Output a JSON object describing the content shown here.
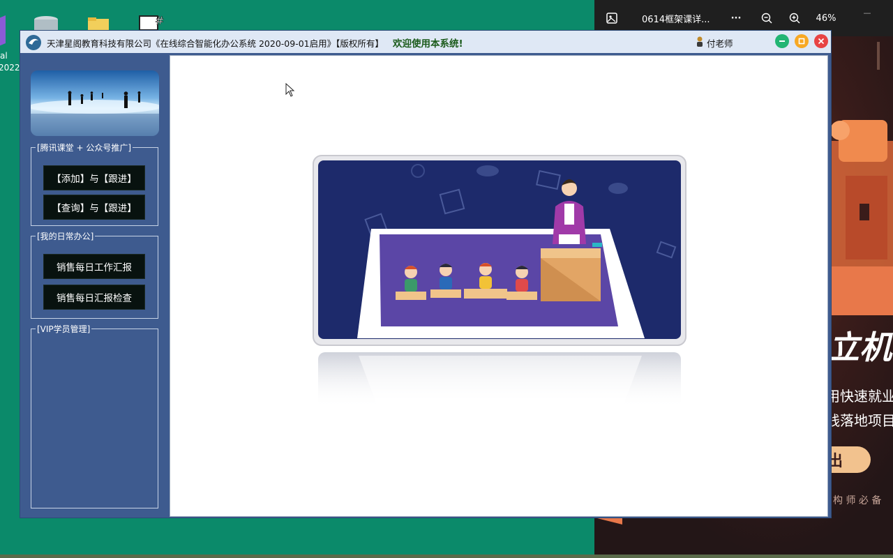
{
  "desktop": {
    "fragment_label_1": "al",
    "fragment_label_2": "2022"
  },
  "viewer": {
    "filename": "0614框架课详...",
    "more": "···",
    "zoom": "46%",
    "minimize": "—",
    "promo": {
      "big_text": "立机",
      "line1": "用快速就业",
      "line2": "践落地项目",
      "button": "出",
      "footer": "构 师 必 备"
    }
  },
  "app": {
    "title": "天津星阁教育科技有限公司《在线综合智能化办公系统  2020-09-01启用》【版权所有】",
    "welcome": "欢迎使用本系统!",
    "user": "付老师",
    "colors": {
      "titlebar": "#dfe8f5",
      "sidebar": "#3e5b8f",
      "min": "#22b573",
      "max": "#f7a823",
      "close": "#e84343"
    }
  },
  "sidebar": {
    "group1": {
      "legend": "[腾讯课堂 + 公众号推广]",
      "buttons": [
        "【添加】与【跟进】",
        "【查询】与【跟进】"
      ]
    },
    "group2": {
      "legend": "[我的日常办公]",
      "buttons": [
        "销售每日工作汇报",
        "销售每日汇报检查"
      ]
    },
    "group3": {
      "legend": "[VIP学员管理]"
    }
  }
}
